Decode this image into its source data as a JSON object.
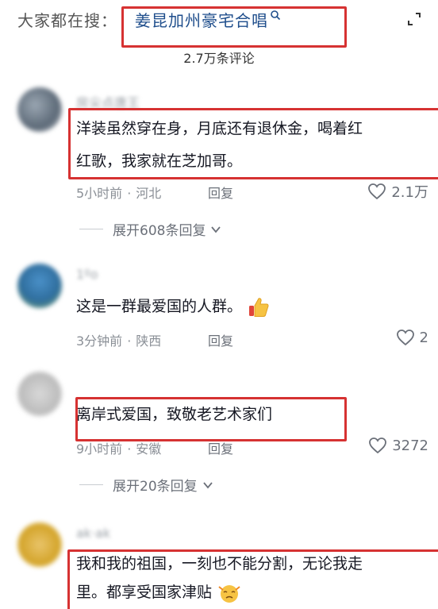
{
  "header": {
    "search_prefix": "大家都在搜：",
    "search_query": "姜昆加州豪宅合唱",
    "comment_count": "2.7万条评论"
  },
  "comments": [
    {
      "username": "房尖点唐王",
      "text_line1": "洋装虽然穿在身，月底还有退休金，喝着红",
      "text_line2": "红歌，我家就在芝加哥。",
      "time": "5小时前",
      "location": "河北",
      "reply_label": "回复",
      "likes": "2.1万",
      "expand_label": "展开608条回复"
    },
    {
      "username": "1ºo",
      "text_line1": "这是一群最爱国的人群。",
      "time": "3分钟前",
      "location": "陕西",
      "reply_label": "回复",
      "likes": "2",
      "emoji": "thumbs-up-emoji"
    },
    {
      "username": "",
      "text_line1": "离岸式爱国，致敬老艺术家们",
      "time": "9小时前",
      "location": "安徽",
      "reply_label": "回复",
      "likes": "3272",
      "expand_label": "展开20条回复"
    },
    {
      "username": "ak·ak",
      "text_line1": "我和我的祖国，一刻也不能分割，无论我走",
      "text_line2": "里。都享受国家津贴",
      "emoji": "crying-face-emoji"
    }
  ],
  "colors": {
    "highlight_box": "#d63232",
    "query_text": "#1f4e8c"
  }
}
